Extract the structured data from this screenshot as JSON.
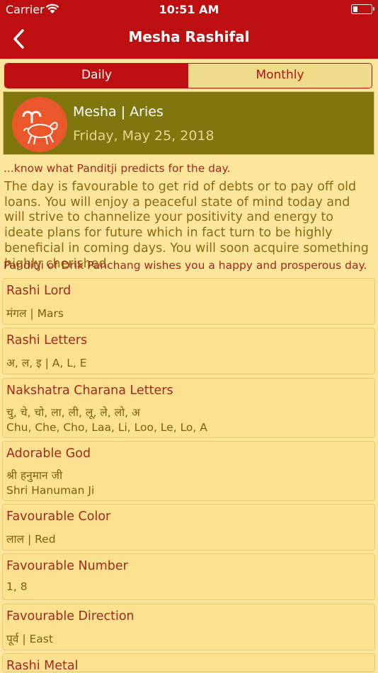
{
  "status": {
    "carrier": "Carrier",
    "time": "10:51 AM"
  },
  "nav": {
    "title": "Mesha Rashifal"
  },
  "tabs": {
    "daily": "Daily",
    "monthly": "Monthly"
  },
  "banner": {
    "name": "Mesha | Aries",
    "date": "Friday, May 25, 2018"
  },
  "intro": "...know what Panditji predicts for the day.",
  "prediction": "The day is favourable to get rid of debts or to pay off old loans. You will enjoy a peaceful state of mind today and will strive to channelize your positivity and energy to ideate plans for future which in fact turn to be highly beneficial in coming days. You will soon acquire something highly cherished.",
  "wish": "Panditji of Drik Panchang wishes you a happy and prosperous day.",
  "cards": [
    {
      "title": "Rashi Lord",
      "line1": "मंगल | Mars"
    },
    {
      "title": "Rashi Letters",
      "line1": "अ, ल, इ | A, L, E"
    },
    {
      "title": "Nakshatra Charana Letters",
      "line1": "चु, चे, चो, ला, ली, लू, ले, लो, अ",
      "line2": "Chu, Che, Cho, Laa, Li, Loo, Le, Lo, A"
    },
    {
      "title": "Adorable God",
      "line1": "श्री हनुमान जी",
      "line2": "Shri Hanuman Ji"
    },
    {
      "title": "Favourable Color",
      "line1": "लाल | Red"
    },
    {
      "title": "Favourable Number",
      "line1": "1, 8"
    },
    {
      "title": "Favourable Direction",
      "line1": "पूर्व | East"
    },
    {
      "title": "Rashi Metal"
    }
  ]
}
